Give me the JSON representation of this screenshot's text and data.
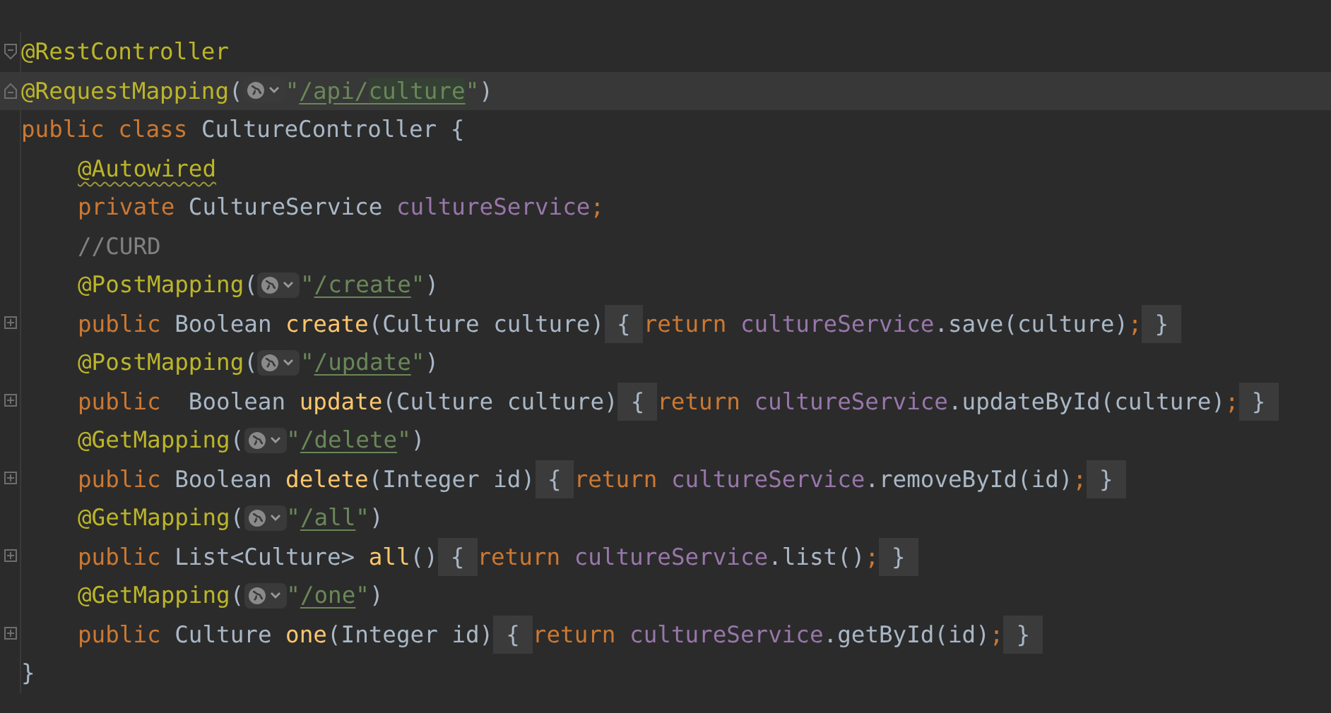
{
  "editor": {
    "lines": [
      {
        "fold_start": true,
        "fold_end": false,
        "collapsed": false,
        "current": false,
        "indented": false,
        "tokens": [
          {
            "kind": "annotation",
            "text": "@RestController"
          }
        ]
      },
      {
        "fold_start": false,
        "fold_end": true,
        "collapsed": false,
        "current": true,
        "indented": false,
        "tokens": [
          {
            "kind": "annotation",
            "text": "@RequestMapping"
          },
          {
            "kind": "plain",
            "text": "("
          },
          {
            "kind": "globe"
          },
          {
            "kind": "string",
            "text": "\""
          },
          {
            "kind": "url",
            "text": "/api/"
          },
          {
            "kind": "url_match",
            "text": "culture"
          },
          {
            "kind": "string",
            "text": "\""
          },
          {
            "kind": "plain",
            "text": ")"
          }
        ]
      },
      {
        "fold_start": false,
        "fold_end": false,
        "collapsed": false,
        "current": false,
        "indented": false,
        "tokens": [
          {
            "kind": "keyword",
            "text": "public class "
          },
          {
            "kind": "plain",
            "text": "CultureController {"
          }
        ]
      },
      {
        "fold_start": false,
        "fold_end": false,
        "collapsed": false,
        "current": false,
        "indented": true,
        "tokens": [
          {
            "kind": "annotation_warning",
            "text": "@Autowired"
          }
        ]
      },
      {
        "fold_start": false,
        "fold_end": false,
        "collapsed": false,
        "current": false,
        "indented": true,
        "tokens": [
          {
            "kind": "keyword",
            "text": "private "
          },
          {
            "kind": "plain",
            "text": "CultureService "
          },
          {
            "kind": "field",
            "text": "cultureService"
          },
          {
            "kind": "keyword",
            "text": ";"
          }
        ]
      },
      {
        "fold_start": false,
        "fold_end": false,
        "collapsed": false,
        "current": false,
        "indented": true,
        "tokens": [
          {
            "kind": "comment",
            "text": "//CURD"
          }
        ]
      },
      {
        "fold_start": false,
        "fold_end": false,
        "collapsed": false,
        "current": false,
        "indented": true,
        "tokens": [
          {
            "kind": "annotation",
            "text": "@PostMapping"
          },
          {
            "kind": "plain",
            "text": "("
          },
          {
            "kind": "globe"
          },
          {
            "kind": "string",
            "text": "\""
          },
          {
            "kind": "url",
            "text": "/create"
          },
          {
            "kind": "string",
            "text": "\""
          },
          {
            "kind": "plain",
            "text": ")"
          }
        ]
      },
      {
        "fold_start": false,
        "fold_end": false,
        "collapsed": true,
        "current": false,
        "indented": true,
        "tokens": [
          {
            "kind": "keyword",
            "text": "public "
          },
          {
            "kind": "plain",
            "text": "Boolean "
          },
          {
            "kind": "method",
            "text": "create"
          },
          {
            "kind": "plain",
            "text": "(Culture culture)"
          },
          {
            "kind": "folded",
            "text": "{"
          },
          {
            "kind": "keyword",
            "text": "return "
          },
          {
            "kind": "field",
            "text": "cultureService"
          },
          {
            "kind": "plain",
            "text": ".save(culture)"
          },
          {
            "kind": "keyword",
            "text": ";"
          },
          {
            "kind": "folded",
            "text": "}"
          }
        ]
      },
      {
        "fold_start": false,
        "fold_end": false,
        "collapsed": false,
        "current": false,
        "indented": true,
        "tokens": [
          {
            "kind": "annotation",
            "text": "@PostMapping"
          },
          {
            "kind": "plain",
            "text": "("
          },
          {
            "kind": "globe"
          },
          {
            "kind": "string",
            "text": "\""
          },
          {
            "kind": "url",
            "text": "/update"
          },
          {
            "kind": "string",
            "text": "\""
          },
          {
            "kind": "plain",
            "text": ")"
          }
        ]
      },
      {
        "fold_start": false,
        "fold_end": false,
        "collapsed": true,
        "current": false,
        "indented": true,
        "tokens": [
          {
            "kind": "keyword",
            "text": "public  "
          },
          {
            "kind": "plain",
            "text": "Boolean "
          },
          {
            "kind": "method",
            "text": "update"
          },
          {
            "kind": "plain",
            "text": "(Culture culture)"
          },
          {
            "kind": "folded",
            "text": "{"
          },
          {
            "kind": "keyword",
            "text": "return "
          },
          {
            "kind": "field",
            "text": "cultureService"
          },
          {
            "kind": "plain",
            "text": ".updateById(culture)"
          },
          {
            "kind": "keyword",
            "text": ";"
          },
          {
            "kind": "folded",
            "text": "}"
          }
        ]
      },
      {
        "fold_start": false,
        "fold_end": false,
        "collapsed": false,
        "current": false,
        "indented": true,
        "tokens": [
          {
            "kind": "annotation",
            "text": "@GetMapping"
          },
          {
            "kind": "plain",
            "text": "("
          },
          {
            "kind": "globe"
          },
          {
            "kind": "string",
            "text": "\""
          },
          {
            "kind": "url",
            "text": "/delete"
          },
          {
            "kind": "string",
            "text": "\""
          },
          {
            "kind": "plain",
            "text": ")"
          }
        ]
      },
      {
        "fold_start": false,
        "fold_end": false,
        "collapsed": true,
        "current": false,
        "indented": true,
        "tokens": [
          {
            "kind": "keyword",
            "text": "public "
          },
          {
            "kind": "plain",
            "text": "Boolean "
          },
          {
            "kind": "method",
            "text": "delete"
          },
          {
            "kind": "plain",
            "text": "(Integer id)"
          },
          {
            "kind": "folded",
            "text": "{"
          },
          {
            "kind": "keyword",
            "text": "return "
          },
          {
            "kind": "field",
            "text": "cultureService"
          },
          {
            "kind": "plain",
            "text": ".removeById(id)"
          },
          {
            "kind": "keyword",
            "text": ";"
          },
          {
            "kind": "folded",
            "text": "}"
          }
        ]
      },
      {
        "fold_start": false,
        "fold_end": false,
        "collapsed": false,
        "current": false,
        "indented": true,
        "tokens": [
          {
            "kind": "annotation",
            "text": "@GetMapping"
          },
          {
            "kind": "plain",
            "text": "("
          },
          {
            "kind": "globe"
          },
          {
            "kind": "string",
            "text": "\""
          },
          {
            "kind": "url",
            "text": "/all"
          },
          {
            "kind": "string",
            "text": "\""
          },
          {
            "kind": "plain",
            "text": ")"
          }
        ]
      },
      {
        "fold_start": false,
        "fold_end": false,
        "collapsed": true,
        "current": false,
        "indented": true,
        "tokens": [
          {
            "kind": "keyword",
            "text": "public "
          },
          {
            "kind": "plain",
            "text": "List<Culture> "
          },
          {
            "kind": "method",
            "text": "all"
          },
          {
            "kind": "plain",
            "text": "()"
          },
          {
            "kind": "folded",
            "text": "{"
          },
          {
            "kind": "keyword",
            "text": "return "
          },
          {
            "kind": "field",
            "text": "cultureService"
          },
          {
            "kind": "plain",
            "text": ".list()"
          },
          {
            "kind": "keyword",
            "text": ";"
          },
          {
            "kind": "folded",
            "text": "}"
          }
        ]
      },
      {
        "fold_start": false,
        "fold_end": false,
        "collapsed": false,
        "current": false,
        "indented": true,
        "tokens": [
          {
            "kind": "annotation",
            "text": "@GetMapping"
          },
          {
            "kind": "plain",
            "text": "("
          },
          {
            "kind": "globe"
          },
          {
            "kind": "string",
            "text": "\""
          },
          {
            "kind": "url",
            "text": "/one"
          },
          {
            "kind": "string",
            "text": "\""
          },
          {
            "kind": "plain",
            "text": ")"
          }
        ]
      },
      {
        "fold_start": false,
        "fold_end": false,
        "collapsed": true,
        "current": false,
        "indented": true,
        "tokens": [
          {
            "kind": "keyword",
            "text": "public "
          },
          {
            "kind": "plain",
            "text": "Culture "
          },
          {
            "kind": "method",
            "text": "one"
          },
          {
            "kind": "plain",
            "text": "(Integer id)"
          },
          {
            "kind": "folded",
            "text": "{"
          },
          {
            "kind": "keyword",
            "text": "return "
          },
          {
            "kind": "field",
            "text": "cultureService"
          },
          {
            "kind": "plain",
            "text": ".getById(id)"
          },
          {
            "kind": "keyword",
            "text": ";"
          },
          {
            "kind": "folded",
            "text": "}"
          }
        ]
      },
      {
        "fold_start": false,
        "fold_end": false,
        "collapsed": false,
        "current": false,
        "indented": false,
        "tokens": [
          {
            "kind": "plain",
            "text": "}"
          }
        ]
      }
    ]
  }
}
